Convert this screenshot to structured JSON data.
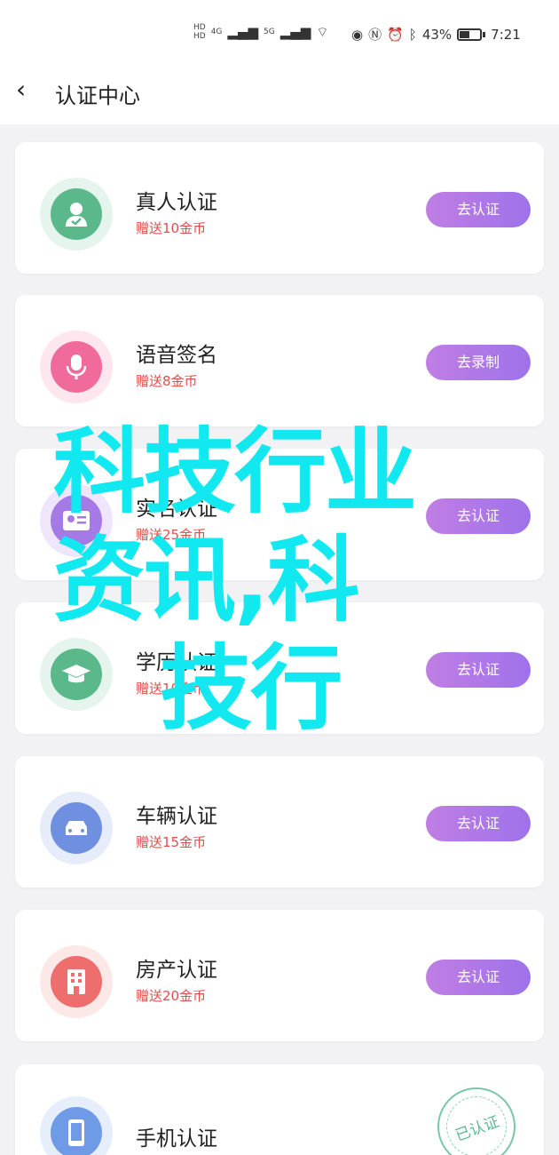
{
  "status_bar": {
    "network_labels": [
      "HD",
      "HD",
      "4G",
      "5G"
    ],
    "battery": "43%",
    "time": "7:21"
  },
  "header": {
    "back_icon": "chevron-left-icon",
    "title": "认证中心"
  },
  "items": [
    {
      "title": "真人认证",
      "reward": "赠送10金币",
      "action": "去认证",
      "icon": "person-check-icon",
      "outer_color": "#e6f4ee",
      "inner_color": "#5ab88b"
    },
    {
      "title": "语音签名",
      "reward": "赠送8金币",
      "action": "去录制",
      "icon": "microphone-icon",
      "outer_color": "#fde6ee",
      "inner_color": "#f06a9c"
    },
    {
      "title": "实名认证",
      "reward": "赠送25金币",
      "action": "去认证",
      "icon": "id-card-icon",
      "outer_color": "#efe6fb",
      "inner_color": "#a57ae6"
    },
    {
      "title": "学历认证",
      "reward": "赠送10金币",
      "action": "去认证",
      "icon": "graduation-cap-icon",
      "outer_color": "#e6f4ee",
      "inner_color": "#5ab88b"
    },
    {
      "title": "车辆认证",
      "reward": "赠送15金币",
      "action": "去认证",
      "icon": "car-icon",
      "outer_color": "#e6ecfa",
      "inner_color": "#6f8fe0"
    },
    {
      "title": "房产认证",
      "reward": "赠送20金币",
      "action": "去认证",
      "icon": "building-icon",
      "outer_color": "#fde8e8",
      "inner_color": "#ee6d6d"
    },
    {
      "title": "手机认证",
      "reward": "",
      "action": "已认证",
      "icon": "phone-icon",
      "outer_color": "#e6eefb",
      "inner_color": "#6f9ae6"
    }
  ],
  "watermark": {
    "line1": "科技行业",
    "line2": "资讯,科",
    "line3": "技行"
  },
  "colors": {
    "button_gradient_start": "#c07ee4",
    "button_gradient_end": "#9e72ea",
    "reward_red": "#e34d4d",
    "watermark_cyan": "#11e8f0"
  }
}
